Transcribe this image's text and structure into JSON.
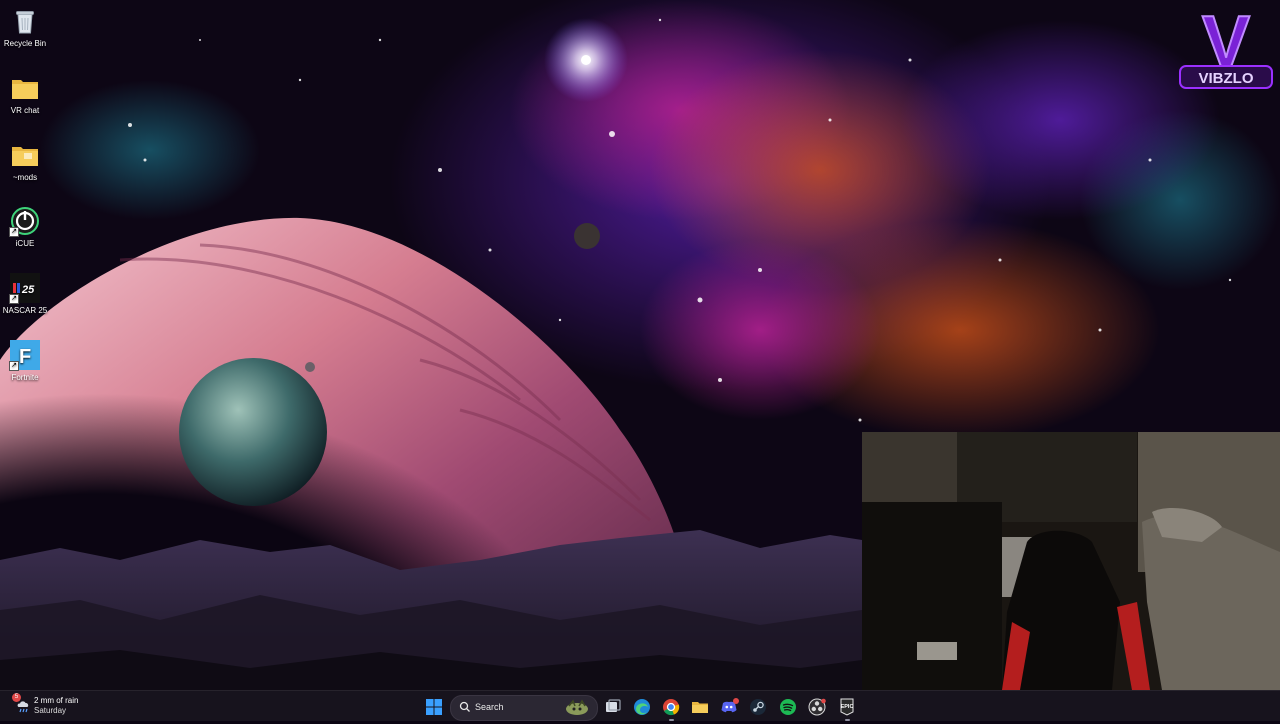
{
  "desktop": {
    "icons": [
      {
        "label": "Recycle Bin"
      },
      {
        "label": "VR chat"
      },
      {
        "label": "~mods"
      },
      {
        "label": "iCUE"
      },
      {
        "label": "NASCAR 25",
        "badge": "25"
      },
      {
        "label": "Fortnite",
        "badge": "F"
      }
    ]
  },
  "overlay": {
    "brand": "VIBZLO",
    "brand_letter": "V"
  },
  "taskbar": {
    "weather": {
      "badge": "5",
      "line1": "2 mm of rain",
      "line2": "Saturday"
    },
    "search": {
      "label": "Search"
    },
    "apps": [
      {
        "name": "start",
        "icon": "windows-start-icon"
      },
      {
        "name": "task-view",
        "icon": "task-view-icon"
      },
      {
        "name": "edge",
        "icon": "edge-icon"
      },
      {
        "name": "chrome",
        "icon": "chrome-icon"
      },
      {
        "name": "file-explorer",
        "icon": "folder-icon"
      },
      {
        "name": "discord",
        "icon": "discord-icon"
      },
      {
        "name": "steam",
        "icon": "steam-icon"
      },
      {
        "name": "spotify",
        "icon": "spotify-icon"
      },
      {
        "name": "obs",
        "icon": "obs-icon"
      },
      {
        "name": "epic-games",
        "icon": "epic-games-icon",
        "text": "EPIC"
      }
    ]
  },
  "colors": {
    "accent": "#9b30ff",
    "taskbar": "#18141e",
    "planet": "#d8889a"
  }
}
